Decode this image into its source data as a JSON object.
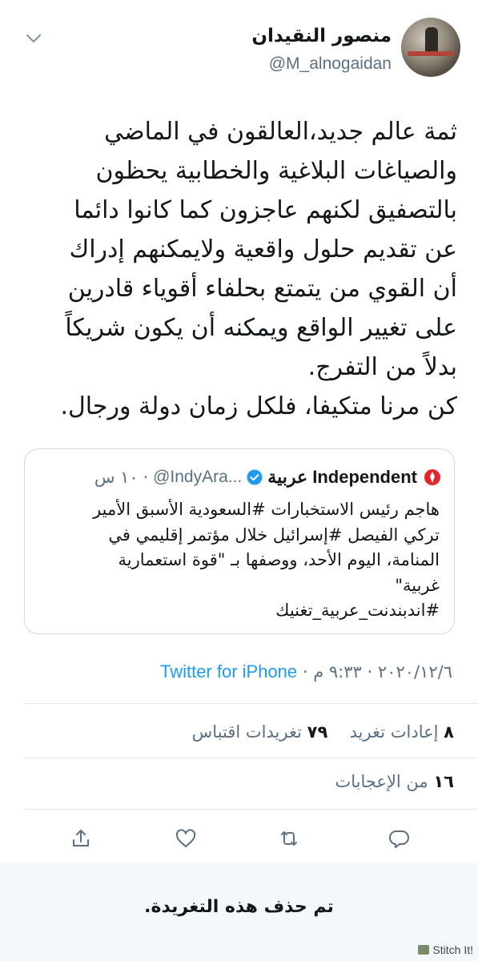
{
  "author": {
    "name": "منصور النقيدان",
    "handle": "@M_alnogaidan"
  },
  "tweet": {
    "lines": [
      "ثمة عالم جديد،العالقون في الماضي",
      "والصياغات البلاغية والخطابية يحظون",
      "بالتصفيق لكنهم عاجزون كما كانوا دائما",
      "عن تقديم حلول واقعية ولايمكنهم إدراك",
      "أن القوي من يتمتع بحلفاء أقوياء قادرين",
      "على تغيير الواقع ويمكنه أن يكون شريكاً",
      "بدلاً من التفرج.",
      "كن مرنا متكيفا، فلكل زمان دولة ورجال."
    ]
  },
  "quote": {
    "name": "Independent عربية",
    "handle": "@IndyAra...",
    "time": "١٠ س",
    "lines": [
      "هاجم رئيس الاستخبارات #السعودية الأسبق الأمير",
      "تركي الفيصل #إسرائيل خلال مؤتمر إقليمي في",
      "المنامة، اليوم الأحد، ووصفها بـ \"قوة استعمارية",
      "غربية\"",
      "#اندبندنت_عربية_تغنيك"
    ]
  },
  "meta": {
    "time": "٩:٣٣ م",
    "date": "٢٠٢٠/١٢/٦",
    "separator": "·",
    "source": "Twitter for iPhone"
  },
  "stats": {
    "retweets_count": "٨",
    "retweets_label": "إعادات تغريد",
    "quotes_count": "٧٩",
    "quotes_label": "تغريدات اقتباس",
    "likes_count": "١٦",
    "likes_label": "من الإعجابات"
  },
  "actions": [
    "reply-icon",
    "retweet-icon",
    "like-icon",
    "share-icon"
  ],
  "banner": {
    "text": "تم حذف هذه التغريدة."
  },
  "watermark": "Stitch It!",
  "colors": {
    "accent": "#1d9bf0",
    "secondary_text": "#5b7083",
    "banner_bg": "#f5f8fa"
  }
}
